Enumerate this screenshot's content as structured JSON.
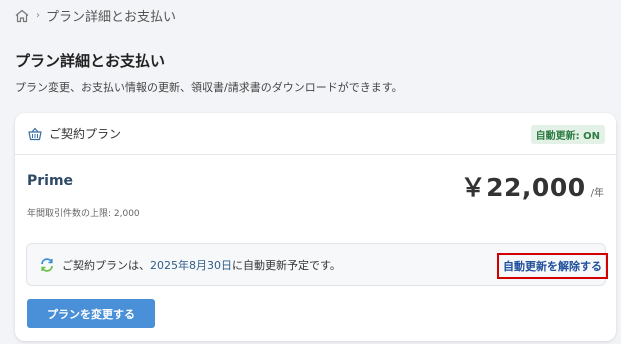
{
  "breadcrumb": {
    "home_icon": "home-icon",
    "current": "プラン詳細とお支払い"
  },
  "page": {
    "title": "プラン詳細とお支払い",
    "description": "プラン変更、お支払い情報の更新、領収書/請求書のダウンロードができます。"
  },
  "card": {
    "header_icon": "basket-icon",
    "header_title": "ご契約プラン",
    "auto_renew_badge": "自動更新: ON",
    "plan_name": "Prime",
    "price": "￥22,000",
    "price_unit": "/年",
    "limit_text": "年間取引件数の上限: 2,000",
    "renewal": {
      "icon": "sync-icon",
      "text_before": "ご契約プランは、",
      "date": "2025年8月30日",
      "text_after": "に自動更新予定です。",
      "cancel_label": "自動更新を解除する"
    },
    "change_button_label": "プランを変更する"
  },
  "colors": {
    "primary_button": "#4a90d9",
    "badge_bg": "#e3f1e6",
    "badge_text": "#2e7d45",
    "highlight_border": "#d40000"
  }
}
